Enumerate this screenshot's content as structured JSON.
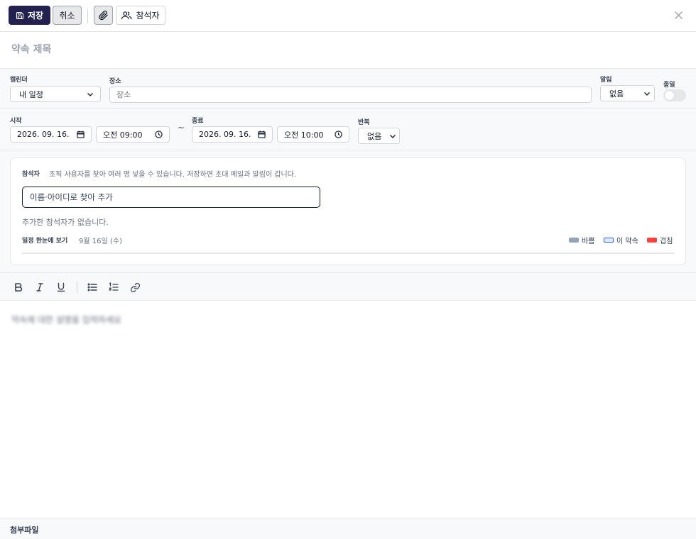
{
  "toolbar": {
    "save_label": "저장",
    "cancel_label": "취소",
    "attendee_label": "참석자"
  },
  "title": {
    "placeholder": "약속 제목"
  },
  "fields": {
    "calendar": {
      "label": "캘린더",
      "value": "내 일정"
    },
    "location": {
      "label": "장소",
      "placeholder": "장소"
    },
    "alarm": {
      "label": "알림",
      "value": "없음"
    },
    "allday": {
      "label": "종일",
      "on": false
    },
    "start": {
      "label": "시작",
      "date": "2026. 09. 16.",
      "time": "오전 09:00"
    },
    "tilde": "~",
    "end": {
      "label": "종료",
      "date": "2026. 09. 16.",
      "time": "오전 10:00"
    },
    "repeat": {
      "label": "반복",
      "value": "없음"
    }
  },
  "attendees": {
    "label": "참석자",
    "description": "조직 사용자를 찾아 여러 명 넣을 수 있습니다. 저장하면 초대 메일과 알림이 갑니다.",
    "search_placeholder": "이름·아이디로 찾아 추가",
    "empty_text": "추가한 참석자가 없습니다.",
    "overview_label": "일정 한눈에 보기",
    "overview_date": "9월 16일 (수)",
    "legend": [
      {
        "label": "바쁨",
        "color": "#94a3b8"
      },
      {
        "label": "이 약속",
        "color": "#dbeafe"
      },
      {
        "label": "겹침",
        "color": "#ef4444"
      }
    ]
  },
  "editor": {
    "tools": [
      "bold-icon",
      "italic-icon",
      "underline-icon",
      "bullet-list-icon",
      "ordered-list-icon",
      "link-icon"
    ],
    "placeholder": "약속에 대한 설명을 입력하세요"
  },
  "attachments": {
    "title": "첨부파일"
  },
  "colors": {
    "primary": "#23224f",
    "busy": "#94a3b8",
    "this": "#dbeafe",
    "overlap": "#ef4444"
  }
}
